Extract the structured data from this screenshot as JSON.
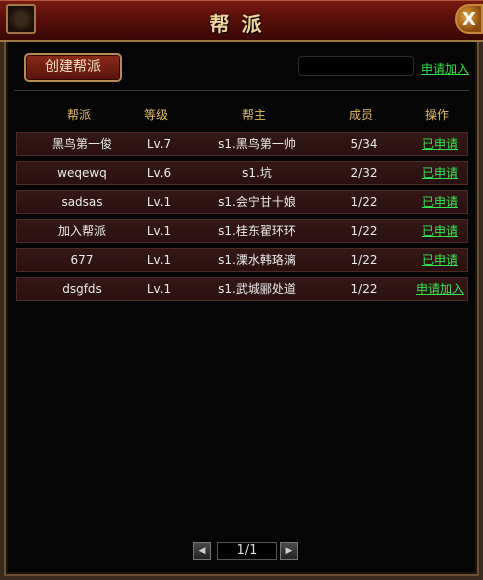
{
  "window": {
    "title": "帮派",
    "close_label": "X"
  },
  "toolbar": {
    "create_label": "创建帮派",
    "search_value": "",
    "search_placeholder": "",
    "apply_label": "申请加入"
  },
  "table": {
    "headers": [
      "帮派",
      "等级",
      "帮主",
      "成员",
      "操作"
    ],
    "rows": [
      {
        "name": "黑鸟第一俊",
        "level": "Lv.7",
        "leader": "s1.黑鸟第一帅",
        "members": "5/34",
        "action": "已申请"
      },
      {
        "name": "weqewq",
        "level": "Lv.6",
        "leader": "s1.坑",
        "members": "2/32",
        "action": "已申请"
      },
      {
        "name": "sadsas",
        "level": "Lv.1",
        "leader": "s1.会宁甘十娘",
        "members": "1/22",
        "action": "已申请"
      },
      {
        "name": "加入帮派",
        "level": "Lv.1",
        "leader": "s1.桂东翟环环",
        "members": "1/22",
        "action": "已申请"
      },
      {
        "name": "677",
        "level": "Lv.1",
        "leader": "s1.溧水韩珞漓",
        "members": "1/22",
        "action": "已申请"
      },
      {
        "name": "dsgfds",
        "level": "Lv.1",
        "leader": "s1.武城郦处道",
        "members": "1/22",
        "action": "申请加入"
      }
    ]
  },
  "pager": {
    "page": "1/1",
    "prev_icon": "triangle-left",
    "next_icon": "triangle-right"
  },
  "colors": {
    "title": "#f0d49a",
    "header": "#e2bd58",
    "link": "#35e84a",
    "row_bg": "#341818"
  }
}
